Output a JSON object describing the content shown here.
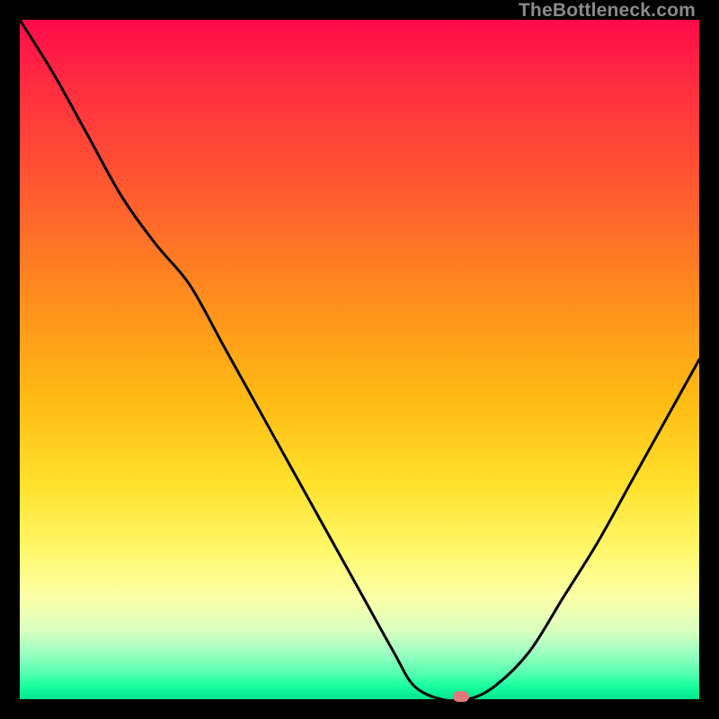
{
  "watermark": "TheBottleneck.com",
  "marker_color": "#e07a7a",
  "chart_data": {
    "type": "line",
    "title": "",
    "xlabel": "",
    "ylabel": "",
    "x": [
      0.0,
      0.05,
      0.1,
      0.15,
      0.2,
      0.25,
      0.3,
      0.35,
      0.4,
      0.45,
      0.5,
      0.55,
      0.58,
      0.62,
      0.66,
      0.7,
      0.75,
      0.8,
      0.85,
      0.9,
      0.95,
      1.0
    ],
    "values": [
      1.0,
      0.92,
      0.83,
      0.74,
      0.67,
      0.61,
      0.52,
      0.43,
      0.34,
      0.25,
      0.16,
      0.07,
      0.02,
      0.0,
      0.0,
      0.02,
      0.07,
      0.15,
      0.23,
      0.32,
      0.41,
      0.5
    ],
    "ylim": [
      0,
      1
    ],
    "xlim": [
      0,
      1
    ],
    "marker_x": 0.65,
    "marker_y": 0.0,
    "notes": "V-shaped bottleneck curve over a vertical red→green gradient. x and y are normalized to the plot rectangle; y=0 is the bottom (green), y=1 is the top (red)."
  }
}
